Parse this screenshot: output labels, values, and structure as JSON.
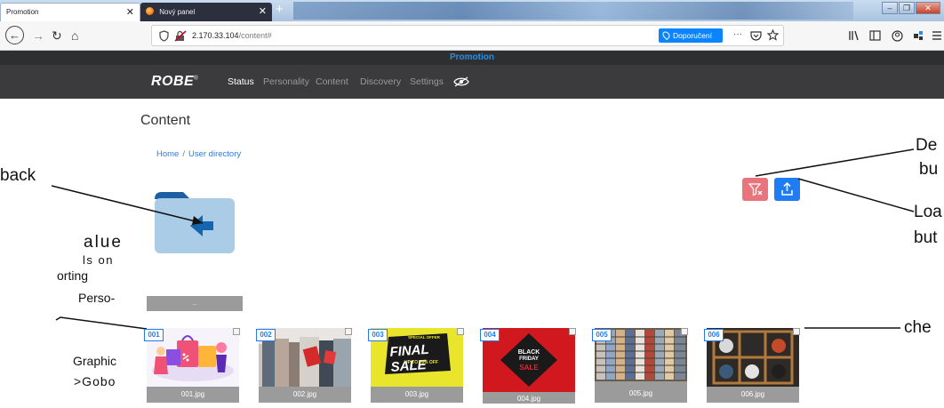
{
  "browser": {
    "tabs": [
      {
        "title": "Promotion",
        "close": "✕",
        "active": true
      },
      {
        "title": "Nový panel",
        "close": "✕",
        "active": false
      }
    ],
    "new_tab": "+",
    "window_controls": [
      "–",
      "❐",
      "✕"
    ],
    "nav": {
      "back": "←",
      "forward": "→",
      "reload": "↻",
      "home": "⌂"
    },
    "url_host": "2.170.33.104",
    "url_path": "/content#",
    "recommendations_label": "Doporučení",
    "page_actions": "···"
  },
  "app": {
    "topbar_title": "Promotion",
    "logo_text": "ROBE",
    "logo_mark": "®",
    "nav": [
      {
        "label": "Status",
        "active": true
      },
      {
        "label": "Personality",
        "active": false
      },
      {
        "label": "Content",
        "active": false
      },
      {
        "label": "Discovery",
        "active": false
      },
      {
        "label": "Settings",
        "active": false
      }
    ],
    "page_title": "Content",
    "breadcrumb": [
      {
        "label": "Home"
      },
      {
        "label": "User directory"
      }
    ],
    "breadcrumb_separator": "/",
    "colors": {
      "accent": "#1f7cf2",
      "filter_button": "#e9747b",
      "topbar_title": "#2a8de2"
    }
  },
  "directory": {
    "back_label": "..",
    "items": [
      {
        "badge": "001",
        "file": "001.jpg"
      },
      {
        "badge": "002",
        "file": "002.jpg"
      },
      {
        "badge": "003",
        "file": "003.jpg"
      },
      {
        "badge": "004",
        "file": "004.jpg"
      },
      {
        "badge": "005",
        "file": "005.jpg"
      },
      {
        "badge": "006",
        "file": "006.jpg"
      }
    ],
    "thumb_003": {
      "top": "SPECIAL OFFER",
      "main": "FINAL SALE",
      "sub": "UP TO 70% OFF"
    },
    "thumb_004": {
      "l1": "BLACK",
      "l2": "FRIDAY",
      "l3": "SALE"
    }
  },
  "annotations": {
    "back": "back",
    "value_lines": [
      "alue",
      "ls  on",
      "orting",
      "Perso-",
      "Graphic",
      ">Gobo"
    ],
    "default_lines": [
      "De",
      "bu"
    ],
    "load_lines": [
      "Loa",
      "but"
    ],
    "check": "che"
  }
}
